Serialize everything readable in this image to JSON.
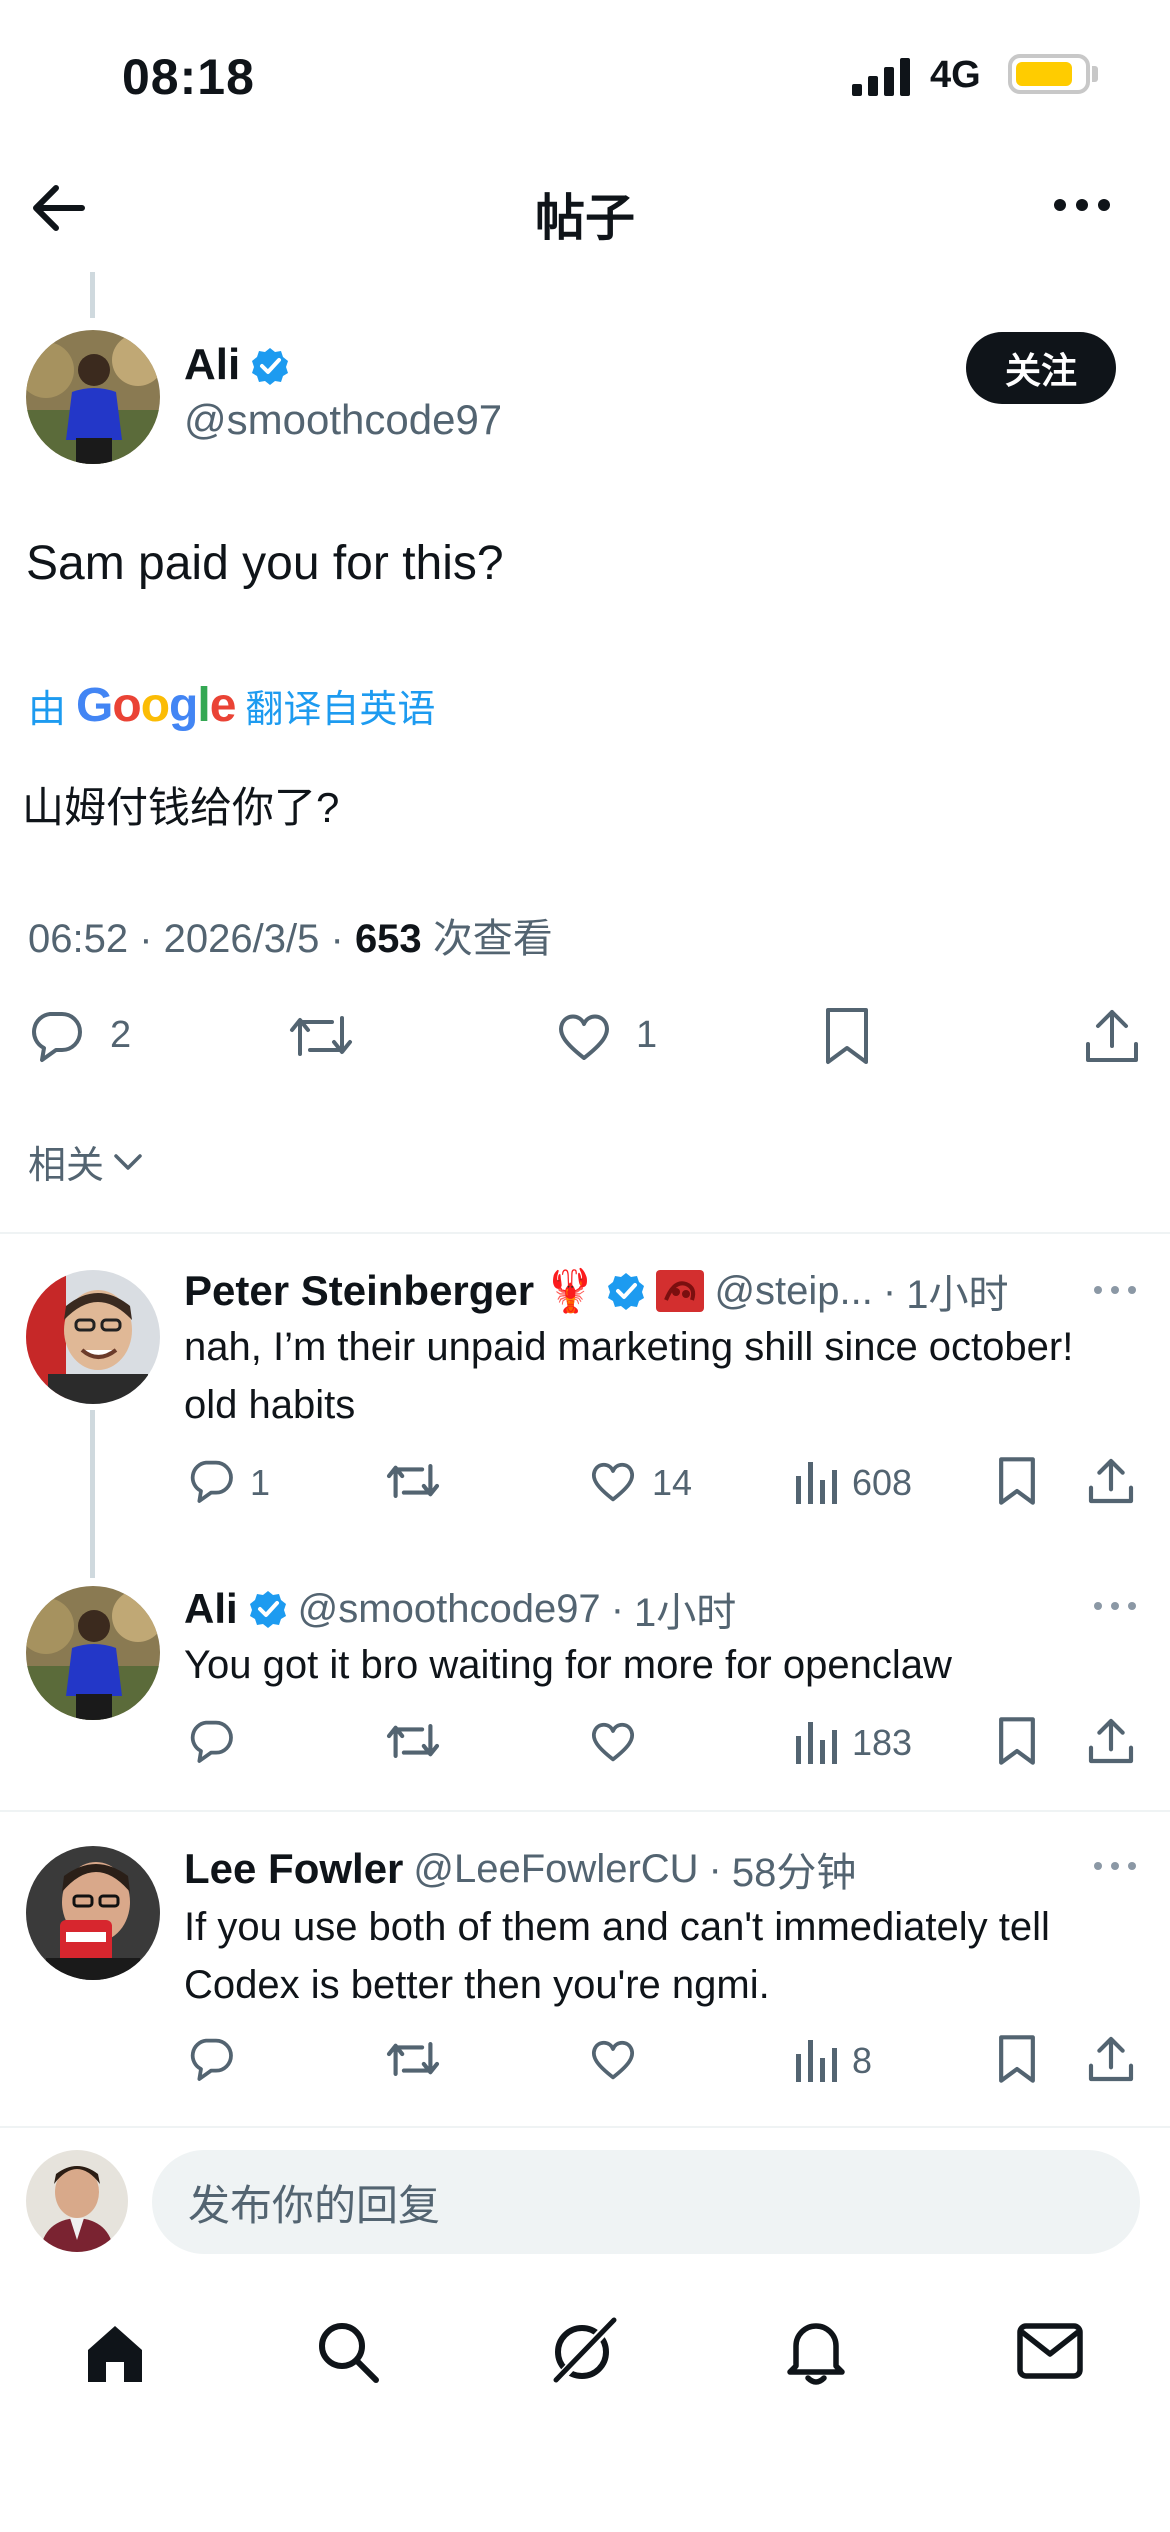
{
  "status_bar": {
    "time": "08:18",
    "network": "4G"
  },
  "header": {
    "title": "帖子"
  },
  "main_post": {
    "author_name": "Ali",
    "handle": "@smoothcode97",
    "follow_label": "关注",
    "text": "Sam paid you for this?",
    "translate_prefix": "由",
    "translate_brand": "Google",
    "translate_suffix": "翻译自英语",
    "translated_text": "山姆付钱给你了?",
    "time": "06:52",
    "date": "2026/3/5",
    "views": "653",
    "views_label": "次查看",
    "replies": "2",
    "likes": "1"
  },
  "related_label": "相关",
  "replies": [
    {
      "name": "Peter Steinberger",
      "emoji": "🦞",
      "handle": "@steip...",
      "time": "1小时",
      "text": "nah, I’m their unpaid marketing shill since october! old habits",
      "replies": "1",
      "likes": "14",
      "views": "608"
    },
    {
      "name": "Ali",
      "handle": "@smoothcode97",
      "time": "1小时",
      "text": "You got it bro waiting for more for openclaw",
      "views": "183"
    },
    {
      "name": "Lee Fowler",
      "handle": "@LeeFowlerCU",
      "time": "58分钟",
      "text": "If you use both of them and can't immediately tell Codex is better then you're ngmi.",
      "views": "8"
    }
  ],
  "compose": {
    "placeholder": "发布你的回复"
  },
  "colors": {
    "accent": "#1d9bf0",
    "text": "#0f1419",
    "muted": "#536471",
    "battery": "#ffcc00"
  },
  "icons": {
    "nav": [
      "home-icon",
      "search-icon",
      "grok-icon",
      "notifications-icon",
      "messages-icon"
    ]
  }
}
